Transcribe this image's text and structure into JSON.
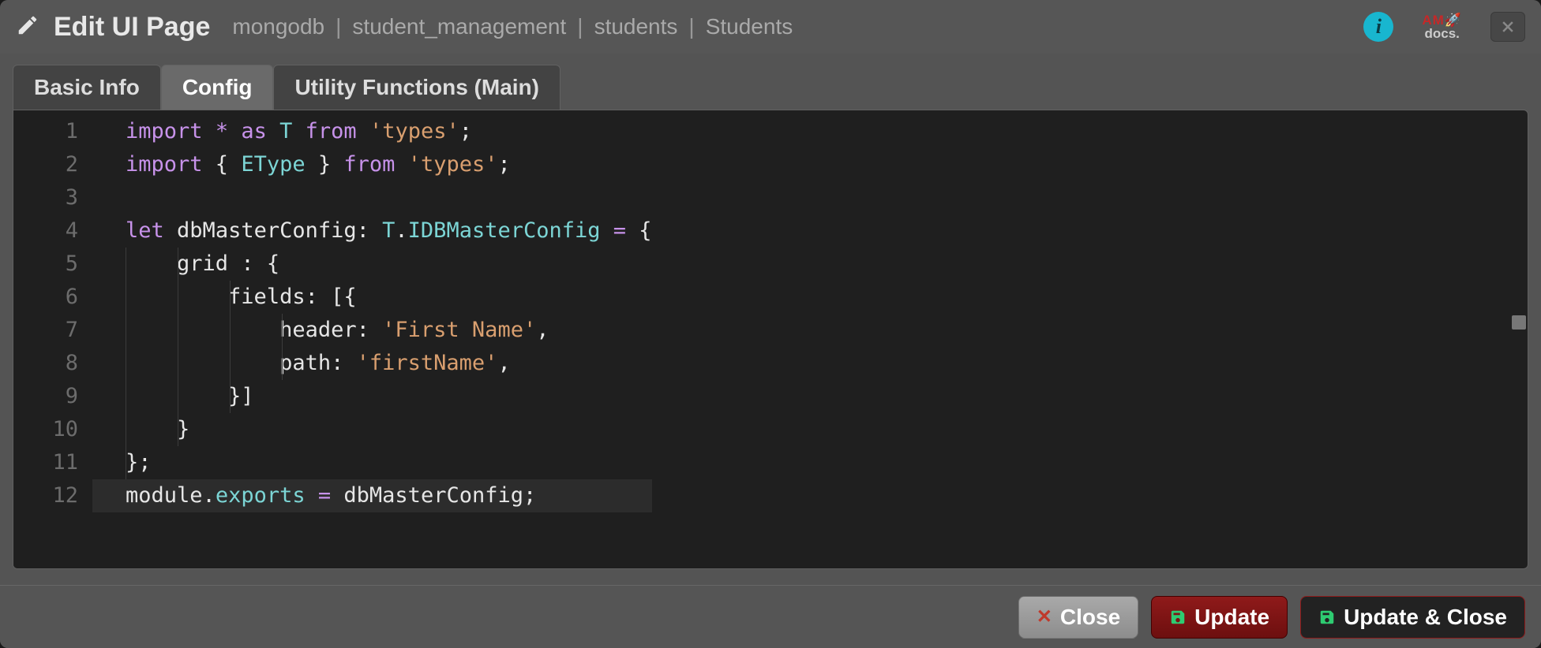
{
  "title": "Edit UI Page",
  "breadcrumbs": [
    "mongodb",
    "student_management",
    "students",
    "Students"
  ],
  "docs_label_top": "AM🚀",
  "docs_label_bottom": "docs.",
  "tabs": [
    {
      "label": "Basic Info",
      "active": false
    },
    {
      "label": "Config",
      "active": true
    },
    {
      "label": "Utility Functions (Main)",
      "active": false
    }
  ],
  "code": {
    "line_count": 12,
    "lines": [
      {
        "n": 1,
        "tokens": [
          [
            "kw",
            "import"
          ],
          [
            "punc",
            " "
          ],
          [
            "op",
            "*"
          ],
          [
            "punc",
            " "
          ],
          [
            "kw",
            "as"
          ],
          [
            "punc",
            " "
          ],
          [
            "type",
            "T"
          ],
          [
            "punc",
            " "
          ],
          [
            "kw",
            "from"
          ],
          [
            "punc",
            " "
          ],
          [
            "str",
            "'types'"
          ],
          [
            "punc",
            ";"
          ]
        ]
      },
      {
        "n": 2,
        "tokens": [
          [
            "kw",
            "import"
          ],
          [
            "punc",
            " { "
          ],
          [
            "type",
            "EType"
          ],
          [
            "punc",
            " } "
          ],
          [
            "kw",
            "from"
          ],
          [
            "punc",
            " "
          ],
          [
            "str",
            "'types'"
          ],
          [
            "punc",
            ";"
          ]
        ]
      },
      {
        "n": 3,
        "tokens": []
      },
      {
        "n": 4,
        "tokens": [
          [
            "kw",
            "let"
          ],
          [
            "punc",
            " "
          ],
          [
            "id",
            "dbMasterConfig"
          ],
          [
            "punc",
            ": "
          ],
          [
            "type",
            "T"
          ],
          [
            "punc",
            "."
          ],
          [
            "type",
            "IDBMasterConfig"
          ],
          [
            "punc",
            " "
          ],
          [
            "op",
            "="
          ],
          [
            "punc",
            " {"
          ]
        ]
      },
      {
        "n": 5,
        "indent": 1,
        "tokens": [
          [
            "punc",
            "    "
          ],
          [
            "id",
            "grid"
          ],
          [
            "punc",
            " : {"
          ]
        ]
      },
      {
        "n": 6,
        "indent": 2,
        "tokens": [
          [
            "punc",
            "        "
          ],
          [
            "id",
            "fields"
          ],
          [
            "punc",
            ": [{"
          ]
        ]
      },
      {
        "n": 7,
        "indent": 3,
        "tokens": [
          [
            "punc",
            "            "
          ],
          [
            "id",
            "header"
          ],
          [
            "punc",
            ": "
          ],
          [
            "str",
            "'First Name'"
          ],
          [
            "punc",
            ","
          ]
        ]
      },
      {
        "n": 8,
        "indent": 3,
        "tokens": [
          [
            "punc",
            "            "
          ],
          [
            "id",
            "path"
          ],
          [
            "punc",
            ": "
          ],
          [
            "str",
            "'firstName'"
          ],
          [
            "punc",
            ","
          ]
        ]
      },
      {
        "n": 9,
        "indent": 2,
        "tokens": [
          [
            "punc",
            "        }]"
          ]
        ]
      },
      {
        "n": 10,
        "indent": 1,
        "tokens": [
          [
            "punc",
            "    }"
          ]
        ]
      },
      {
        "n": 11,
        "tokens": [
          [
            "punc",
            "};"
          ]
        ]
      },
      {
        "n": 12,
        "hl": true,
        "tokens": [
          [
            "mod",
            "module"
          ],
          [
            "punc",
            "."
          ],
          [
            "exp",
            "exports"
          ],
          [
            "punc",
            " "
          ],
          [
            "op",
            "="
          ],
          [
            "punc",
            " "
          ],
          [
            "id",
            "dbMasterConfig"
          ],
          [
            "punc",
            ";"
          ]
        ]
      }
    ]
  },
  "footer": {
    "close": "Close",
    "update": "Update",
    "update_close": "Update & Close"
  }
}
